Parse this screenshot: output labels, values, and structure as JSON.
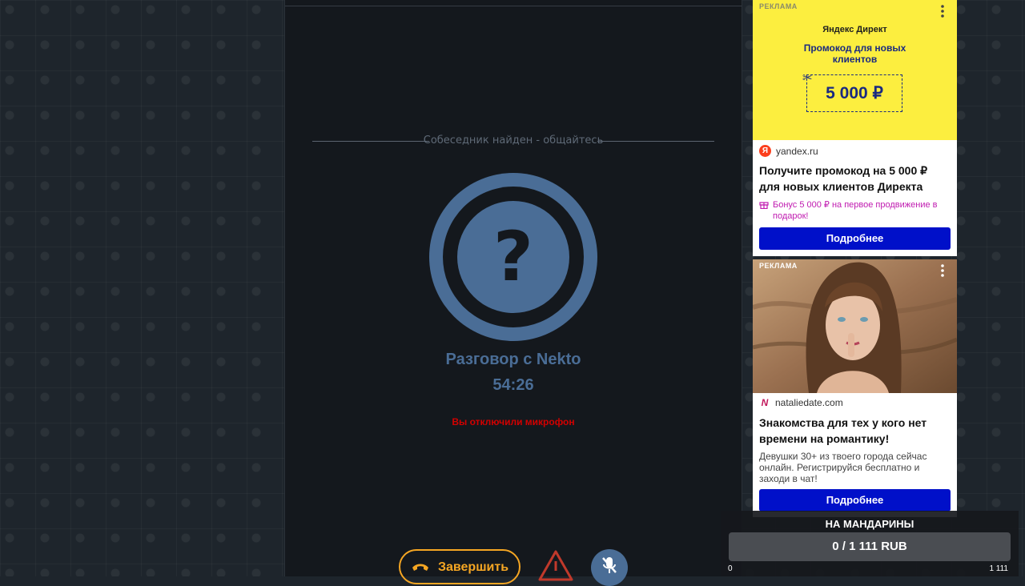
{
  "chat": {
    "divider_text": "Собеседник найден - общайтесь",
    "conversation_title": "Разговор с Nekto",
    "timer": "54:26",
    "mic_warning": "Вы отключили микрофон",
    "end_button_label": "Завершить",
    "avatar_glyph": "?"
  },
  "ads": [
    {
      "label": "РЕКЛАМА",
      "banner_brand": "Яндекс Директ",
      "banner_headline": "Промокод для новых клиентов",
      "coupon_amount": "5 000 ₽",
      "source_logo": "Я",
      "source": "yandex.ru",
      "title": "Получите промокод на 5 000 ₽ для новых клиентов Директа",
      "bonus": "Бонус 5 000 ₽ на первое продвижение в подарок!",
      "button": "Подробнее"
    },
    {
      "label": "РЕКЛАМА",
      "source_logo": "N",
      "source": "nataliedate.com",
      "title": "Знакомства для тех у кого нет времени на романтику!",
      "description": "Девушки 30+ из твоего города сейчас онлайн. Регистрируйся бесплатно и заходи в чат!",
      "button": "Подробнее"
    }
  ],
  "donation": {
    "title": "НА МАНДАРИНЫ",
    "progress": "0 / 1 111 RUB",
    "min": "0",
    "max": "1 111",
    "fraction": 0
  },
  "colors": {
    "accent": "#4a6d96",
    "end_button": "#f5a623",
    "warning": "#d30000",
    "ad_button": "#0010c9",
    "banner_yellow": "#fcee3f"
  }
}
